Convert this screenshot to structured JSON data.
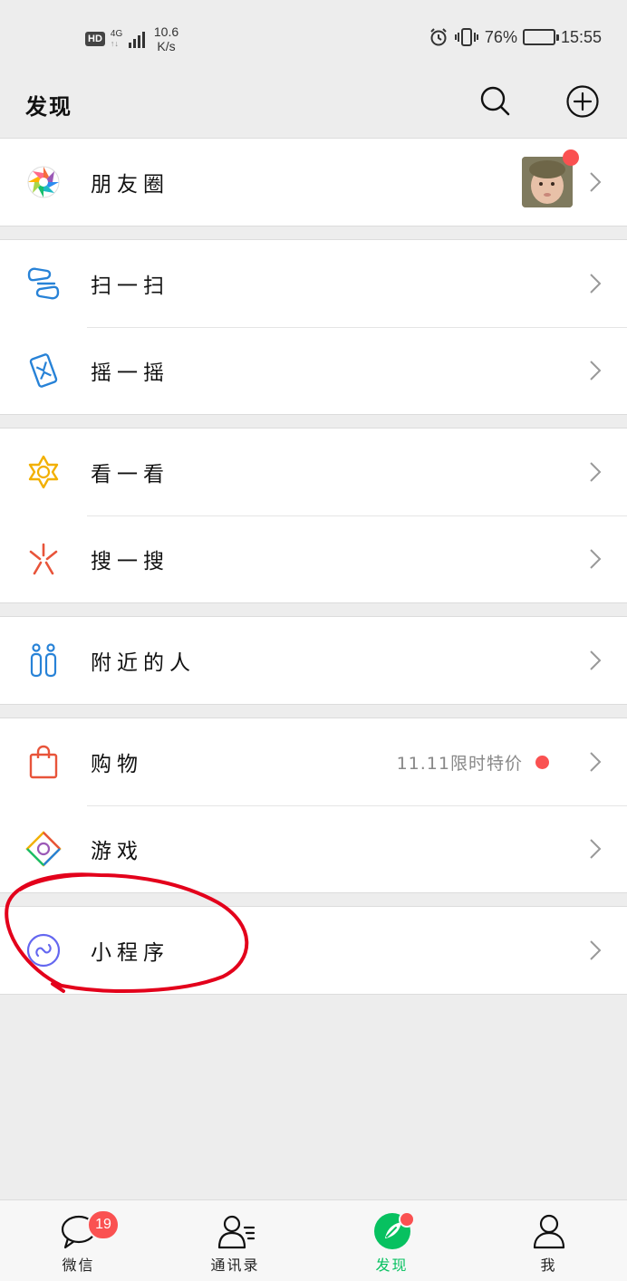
{
  "status_bar": {
    "hd": "HD",
    "network": "4G",
    "network_sub": "↑↓",
    "speed_value": "10.6",
    "speed_unit": "K/s",
    "battery": "76%",
    "time": "15:55",
    "battery_level": 0.76
  },
  "header": {
    "title": "发现",
    "search_icon": "search-icon",
    "add_icon": "plus-circle-icon"
  },
  "groups": [
    [
      {
        "label": "朋友圈",
        "icon": "moments-icon",
        "has_thumb": true
      }
    ],
    [
      {
        "label": "扫一扫",
        "icon": "scan-icon"
      },
      {
        "label": "摇一摇",
        "icon": "shake-icon"
      }
    ],
    [
      {
        "label": "看一看",
        "icon": "top-stories-icon"
      },
      {
        "label": "搜一搜",
        "icon": "search-feature-icon"
      }
    ],
    [
      {
        "label": "附近的人",
        "icon": "nearby-people-icon"
      }
    ],
    [
      {
        "label": "购物",
        "icon": "shopping-bag-icon",
        "extra": "11.11限时特价"
      },
      {
        "label": "游戏",
        "icon": "games-icon"
      }
    ],
    [
      {
        "label": "小程序",
        "icon": "mini-program-icon"
      }
    ]
  ],
  "tabbar": {
    "tabs": [
      {
        "label": "微信",
        "icon": "chat-bubble-icon",
        "badge": "19"
      },
      {
        "label": "通讯录",
        "icon": "contacts-icon"
      },
      {
        "label": "发现",
        "icon": "discover-compass-icon",
        "active": true
      },
      {
        "label": "我",
        "icon": "me-person-icon"
      }
    ]
  },
  "colors": {
    "accent_green": "#07c160",
    "badge_red": "#fa5151",
    "annotation_red": "#e3001b",
    "background": "#ededed"
  }
}
